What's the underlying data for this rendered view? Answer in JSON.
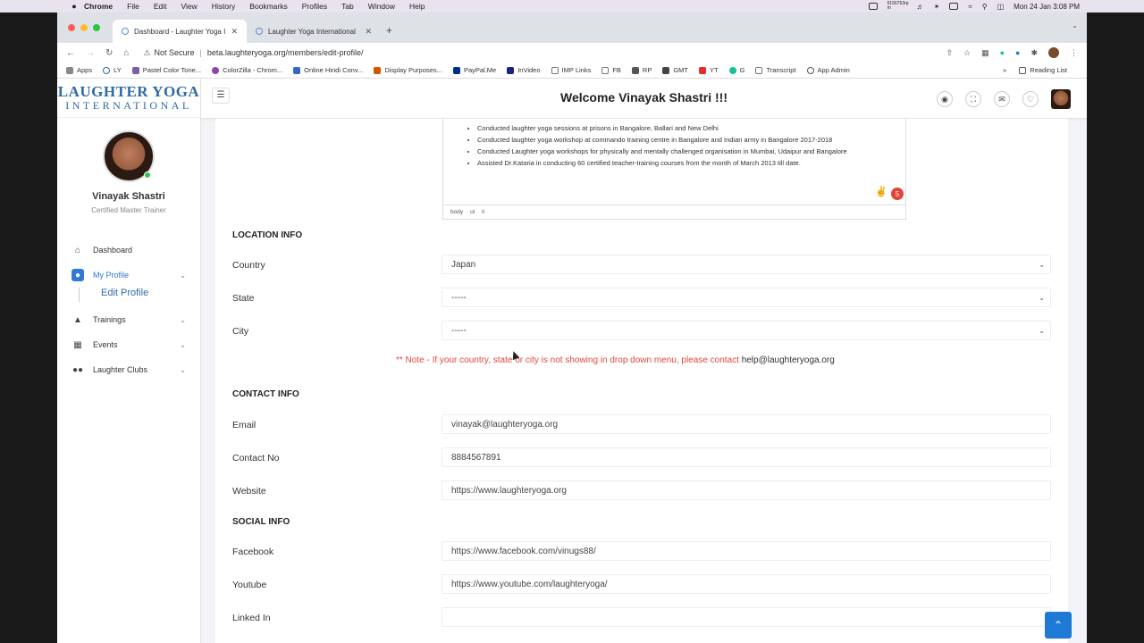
{
  "os_menubar": {
    "app": "Chrome",
    "items": [
      "File",
      "Edit",
      "View",
      "History",
      "Bookmarks",
      "Profiles",
      "Tab",
      "Window",
      "Help"
    ],
    "clock": "Mon 24 Jan  3:08 PM",
    "network": "5156753rp m"
  },
  "browser": {
    "tabs": [
      {
        "title": "Dashboard - Laughter Yoga Int",
        "active": true
      },
      {
        "title": "Laughter Yoga International",
        "active": false
      }
    ],
    "address": {
      "security": "Not Secure",
      "url": "beta.laughteryoga.org/members/edit-profile/"
    },
    "bookmarks": [
      "Apps",
      "LY",
      "Pastel Color Tone...",
      "ColorZilla - Chrom...",
      "Online Hindi Conv...",
      "Display Purposes...",
      "PayPal.Me",
      "InVideo",
      "IMP Links",
      "FB",
      "RP",
      "GMT",
      "YT",
      "G",
      "Transcript",
      "App Admin"
    ],
    "reading_list": "Reading List"
  },
  "logo": {
    "line1": "LAUGHTER YOGA",
    "line2": "INTERNATIONAL"
  },
  "user": {
    "name": "Vinayak Shastri",
    "role": "Certified Master Trainer"
  },
  "sidebar": {
    "items": [
      {
        "label": "Dashboard",
        "icon": "home-icon"
      },
      {
        "label": "My Profile",
        "icon": "user-icon"
      },
      {
        "label": "Trainings",
        "icon": "trainer-icon"
      },
      {
        "label": "Events",
        "icon": "calendar-icon"
      },
      {
        "label": "Laughter Clubs",
        "icon": "group-icon"
      }
    ],
    "submenu": {
      "edit_profile": "Edit Profile"
    }
  },
  "header": {
    "welcome": "Welcome Vinayak Shastri !!!"
  },
  "editor": {
    "bullets": [
      "Conducted laughter yoga sessions at prisons in Bangalore, Ballari and New Delhi",
      "Conducted laughter yoga workshop at commando training centre in Bangalore and Indian army in Bangalore 2017-2018",
      "Conducted Laughter yoga workshops for physically and mentally challenged organisation in Mumbai, Udaipur and Bangalore",
      "Assisted Dr.Kataria in conducting 60 certified teacher-training courses from the month of March 2013 till date."
    ],
    "status_path": [
      "body",
      "ul",
      "li"
    ],
    "badge_count": "5"
  },
  "location": {
    "title": "LOCATION INFO",
    "country_label": "Country",
    "country_value": "Japan",
    "state_label": "State",
    "state_value": "-----",
    "city_label": "City",
    "city_value": "-----",
    "note": "** Note - If your country, state or city is not showing in drop down menu, please contact ",
    "note_email": "help@laughteryoga.org"
  },
  "contact": {
    "title": "CONTACT INFO",
    "email_label": "Email",
    "email_value": "vinayak@laughteryoga.org",
    "phone_label": "Contact No",
    "phone_value": "8884567891",
    "website_label": "Website",
    "website_value": "https://www.laughteryoga.org"
  },
  "social": {
    "title": "SOCIAL INFO",
    "facebook_label": "Facebook",
    "facebook_value": "https://www.facebook.com/vinugs88/",
    "youtube_label": "Youtube",
    "youtube_value": "https://www.youtube.com/laughteryoga/",
    "linkedin_label": "Linked In",
    "linkedin_value": ""
  }
}
